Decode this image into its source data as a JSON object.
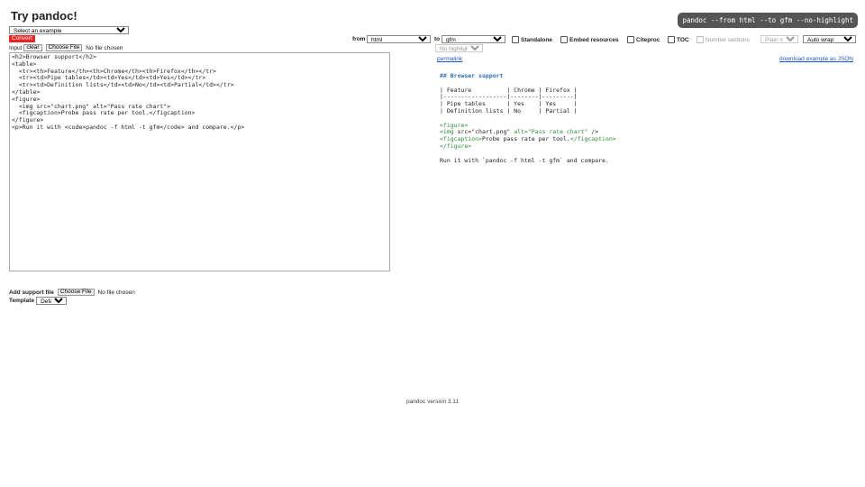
{
  "header": {
    "title": "Try pandoc!",
    "command": "pandoc --from html --to gfm --no-highlight"
  },
  "example_select": {
    "value": "Select an example"
  },
  "convert_label": "Convert",
  "input_bar": {
    "label": "Input",
    "clear": "clear",
    "choose_file": "Choose File",
    "no_file": "No file chosen"
  },
  "controls": {
    "from_label": "from",
    "from_value": "html",
    "to_label": "to",
    "to_value": "gfm",
    "standalone": "Standalone",
    "embed": "Embed resources",
    "citeproc": "Citeproc",
    "toc": "TOC",
    "number_sections": "Number sections",
    "math": "Plain math",
    "wrap": "Auto wrap",
    "highlight": "No highlighting"
  },
  "input_text": "<h2>Browser support</h2>\n<table>\n  <tr><th>Feature</th><th>Chrome</th><th>Firefox</th></tr>\n  <tr><td>Pipe tables</td><td>Yes</td><td>Yes</td></tr>\n  <tr><td>Definition lists</td><td>No</td><td>Partial</td></tr>\n</table>\n<figure>\n  <img src=\"chart.png\" alt=\"Pass rate chart\">\n  <figcaption>Probe pass rate per tool.</figcaption>\n</figure>\n<p>Run it with <code>pandoc -f html -t gfm</code> and compare.</p>",
  "output": {
    "permalink": "permalink",
    "download": "download example as JSON",
    "heading": "## Browser support",
    "table_lines": [
      "| Feature          | Chrome | Firefox |",
      "|------------------|--------|---------|",
      "| Pipe tables      | Yes    | Yes     |",
      "| Definition lists | No     | Partial |"
    ],
    "fig_open": "<figure>",
    "img_line_tag": "<img",
    "img_line_src": " src=\"chart.png\"",
    "img_line_alt": " alt=\"Pass rate chart\"",
    "img_line_end": " />",
    "cap_open": "<figcaption>",
    "cap_text": "Probe pass rate per tool.",
    "cap_close": "</figcaption>",
    "fig_close": "</figure>",
    "run_line": "Run it with `pandoc -f html -t gfm` and compare."
  },
  "support": {
    "label": "Add support file",
    "choose_file": "Choose File",
    "no_file": "No file chosen"
  },
  "template": {
    "label": "Template",
    "value": "Default"
  },
  "footer": "pandoc version 3.11"
}
